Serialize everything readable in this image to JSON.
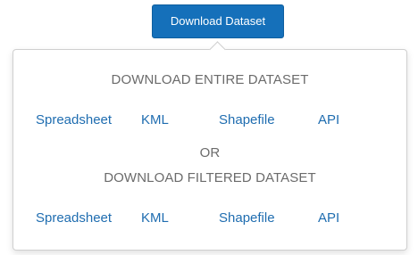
{
  "button": {
    "label": "Download Dataset"
  },
  "panel": {
    "entire_heading": "DOWNLOAD ENTIRE DATASET",
    "separator": "OR",
    "filtered_heading": "DOWNLOAD FILTERED DATASET",
    "entire_links": [
      "Spreadsheet",
      "KML",
      "Shapefile",
      "API"
    ],
    "filtered_links": [
      "Spreadsheet",
      "KML",
      "Shapefile",
      "API"
    ]
  },
  "colors": {
    "button_bg": "#1570ba",
    "link": "#1f6db0",
    "heading": "#6b6b6b"
  }
}
